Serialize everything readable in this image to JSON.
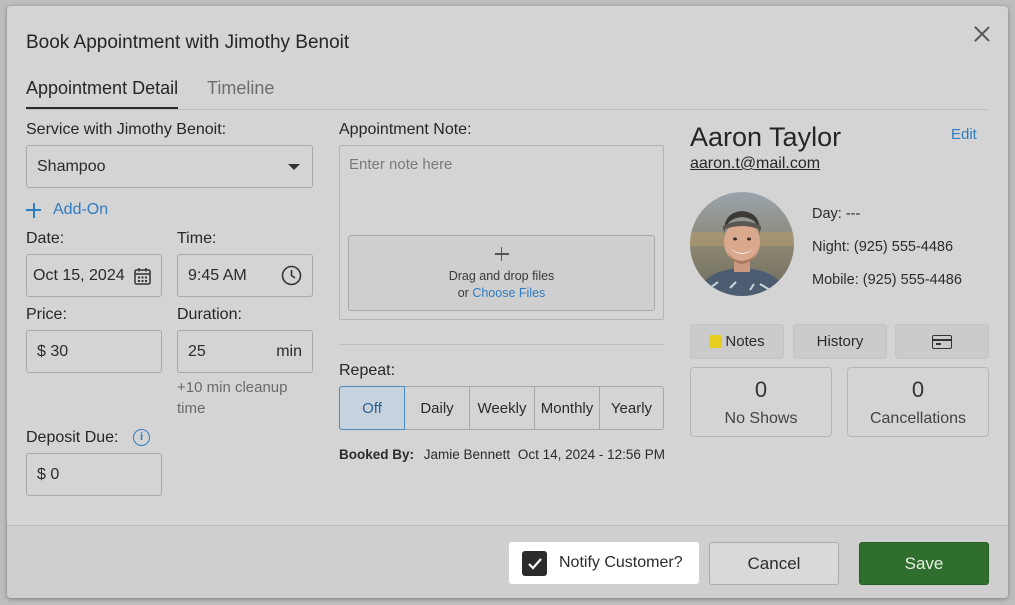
{
  "dialog": {
    "title": "Book Appointment with Jimothy Benoit"
  },
  "tabs": [
    {
      "label": "Appointment Detail",
      "active": true
    },
    {
      "label": "Timeline",
      "active": false
    }
  ],
  "service": {
    "label": "Service with Jimothy Benoit:",
    "value": "Shampoo"
  },
  "addon": {
    "label": "Add-On"
  },
  "date": {
    "label": "Date:",
    "value": "Oct 15, 2024"
  },
  "time": {
    "label": "Time:",
    "value": "9:45 AM"
  },
  "price": {
    "label": "Price:",
    "value": "$ 30"
  },
  "duration": {
    "label": "Duration:",
    "value": "25",
    "unit": "min",
    "cleanup": "+10 min cleanup time"
  },
  "deposit": {
    "label": "Deposit Due:",
    "value": "$ 0"
  },
  "note": {
    "label": "Appointment Note:",
    "placeholder": "Enter note here",
    "drop_text": "Drag and drop files",
    "drop_or": "or",
    "choose_files": "Choose Files"
  },
  "repeat": {
    "label": "Repeat:",
    "options": [
      "Off",
      "Daily",
      "Weekly",
      "Monthly",
      "Yearly"
    ],
    "selected": "Off"
  },
  "booked": {
    "label": "Booked By:",
    "name": "Jamie Bennett",
    "datetime": "Oct 14, 2024 - 12:56 PM"
  },
  "customer": {
    "name": "Aaron Taylor",
    "edit_label": "Edit",
    "email": "aaron.t@mail.com",
    "day": "Day: ---",
    "night": "Night: (925) 555-4486",
    "mobile": "Mobile: (925) 555-4486",
    "notes_label": "Notes",
    "history_label": "History",
    "no_shows_count": "0",
    "no_shows_label": "No Shows",
    "cancellations_count": "0",
    "cancellations_label": "Cancellations"
  },
  "footer": {
    "notify_label": "Notify Customer?",
    "notify_checked": true,
    "cancel_label": "Cancel",
    "save_label": "Save"
  },
  "colors": {
    "accent": "#2e7cc1",
    "save": "#2f6e2c",
    "sticky_note": "#e6cf1e"
  },
  "icons": [
    "close-icon",
    "plus-icon",
    "calendar-icon",
    "clock-icon",
    "info-icon",
    "sticky-note-icon",
    "credit-card-icon",
    "checkmark-icon",
    "dropdown-caret-icon"
  ]
}
